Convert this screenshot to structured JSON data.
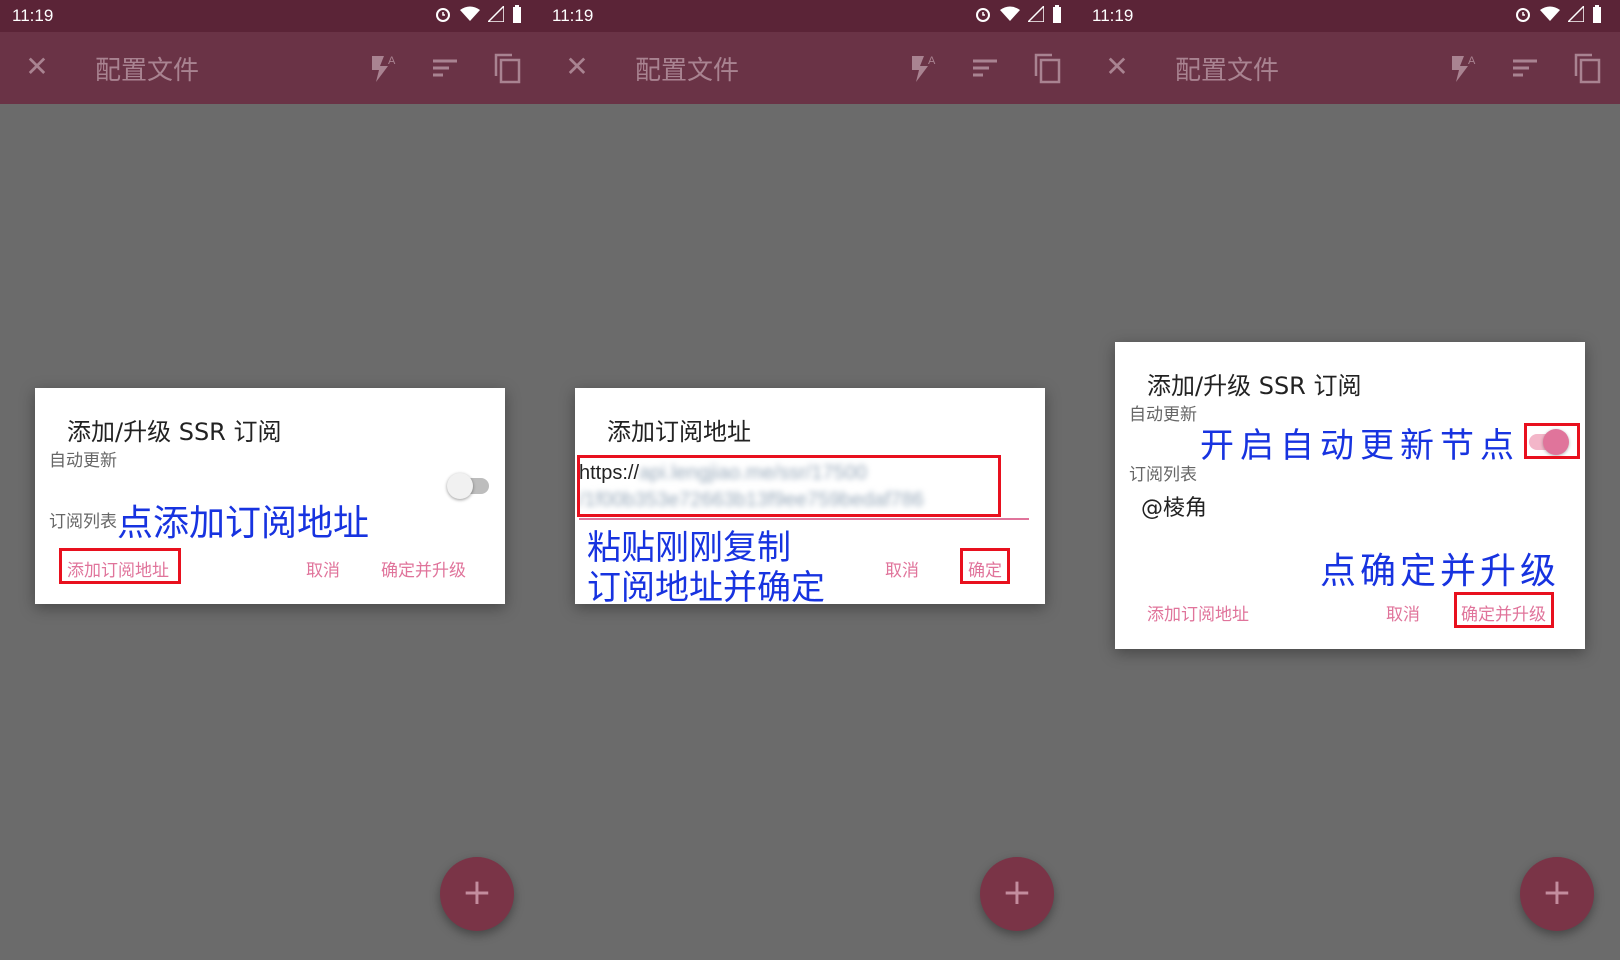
{
  "status": {
    "time": "11:19"
  },
  "appbar": {
    "title": "配置文件"
  },
  "fab": {
    "label": "+"
  },
  "panel1": {
    "dialog_title": "添加/升级 SSR 订阅",
    "auto_update_label": "自动更新",
    "sub_list_label": "订阅列表",
    "add_button": "添加订阅地址",
    "cancel_button": "取消",
    "confirm_button": "确定并升级",
    "annotation": "点添加订阅地址",
    "auto_update_on": false
  },
  "panel2": {
    "dialog_title": "添加订阅地址",
    "url_line1_visible": "https://",
    "url_line1_blurred": "api.lengjiao.me/ssr/17500",
    "url_line2_blurred": "/1f00b353e72663b13f9ee759bedaf786",
    "cancel_button": "取消",
    "confirm_button": "确定",
    "annotation_line1": "粘贴刚刚复制",
    "annotation_line2": "订阅地址并确定"
  },
  "panel3": {
    "dialog_title": "添加/升级 SSR 订阅",
    "auto_update_label": "自动更新",
    "sub_list_label": "订阅列表",
    "sub_item": "@棱角",
    "add_button": "添加订阅地址",
    "cancel_button": "取消",
    "confirm_button": "确定并升级",
    "annotation_toggle": "开启自动更新节点",
    "annotation_confirm": "点确定并升级",
    "auto_update_on": true
  },
  "colors": {
    "statusbar": "#5b2437",
    "appbar": "#6a3346",
    "accent": "#e0749b",
    "annotation": "#1733e0",
    "highlight": "#e8101e"
  },
  "icons": [
    "close-icon",
    "flash-auto-icon",
    "sort-icon",
    "copy-icon",
    "alarm-icon",
    "wifi-icon",
    "signal-icon",
    "battery-icon"
  ]
}
